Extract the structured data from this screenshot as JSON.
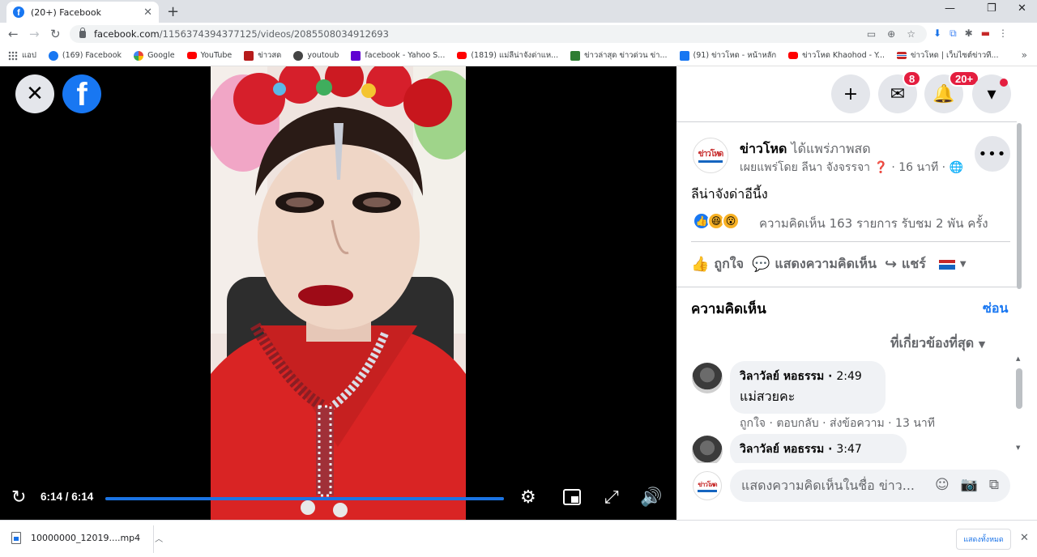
{
  "browser": {
    "tab_title": "(20+) Facebook",
    "tab_close": "✕",
    "new_tab": "+",
    "url_domain": "facebook.com",
    "url_path": "/1156374394377125/videos/2085508034912693",
    "window_controls": [
      "—",
      "❐",
      "✕"
    ]
  },
  "bookmarks": [
    {
      "label": "แอป",
      "color": "#5f6368"
    },
    {
      "label": "(169) Facebook",
      "color": "#1877f2"
    },
    {
      "label": "Google",
      "color": "#4285f4"
    },
    {
      "label": "YouTube",
      "color": "#ff0000"
    },
    {
      "label": "ข่าวสด",
      "color": "#b71c1c"
    },
    {
      "label": "youtoub",
      "color": "#444444"
    },
    {
      "label": "facebook - Yahoo S...",
      "color": "#6001d2"
    },
    {
      "label": "(1819) แม่ลีน่าจังด่าแห...",
      "color": "#ff0000"
    },
    {
      "label": "ข่าวล่าสุด ข่าวด่วน ข่า...",
      "color": "#2e7d32"
    },
    {
      "label": "(91) ข่าวโหด - หน้าหลัก",
      "color": "#1877f2"
    },
    {
      "label": "ข่าวโหด Khaohod - Y...",
      "color": "#ff0000"
    },
    {
      "label": "ข่าวโหด | เว็บไซต์ข่าวที...",
      "color": "#c62828"
    }
  ],
  "video": {
    "time_display": "6:14 / 6:14",
    "progress": 1.0,
    "close_label": "✕",
    "fb_logo": "f"
  },
  "header_icons": {
    "create": "+",
    "messenger_badge": "8",
    "notifications_badge": "20+"
  },
  "post": {
    "page_logo_text": "ข่าวโหด",
    "page_name": "ข่าวโหด",
    "activity": "ได้แพร่ภาพสด",
    "meta": "เผยแพร่โดย ลีนา จังจรรจา ❓ · 16 นาที · 🌐",
    "caption": "ลีน่าจังด่าอีนี้ง",
    "stats": "ความคิดเห็น 163 รายการ  รับชม 2 พัน ครั้ง",
    "actions": {
      "like": "ถูกใจ",
      "comment": "แสดงความคิดเห็น",
      "share": "แชร์"
    }
  },
  "comments": {
    "title": "ความคิดเห็น",
    "hide": "ซ่อน",
    "sort": "ที่เกี่ยวข้องที่สุด",
    "items": [
      {
        "name": "วิลาวัลย์ หอธรรม",
        "time": "2:49",
        "text": "แม่สวยคะ",
        "links": "ถูกใจ · ตอบกลับ · ส่งข้อความ · 13 นาที"
      },
      {
        "name": "วิลาวัลย์ หอธรรม",
        "time": "3:47"
      }
    ],
    "composer_placeholder": "แสดงความคิดเห็นในชื่อ ข่าว..."
  },
  "downloads": {
    "file_name": "10000000_12019....mp4",
    "show_all": "แสดงทั้งหมด"
  }
}
